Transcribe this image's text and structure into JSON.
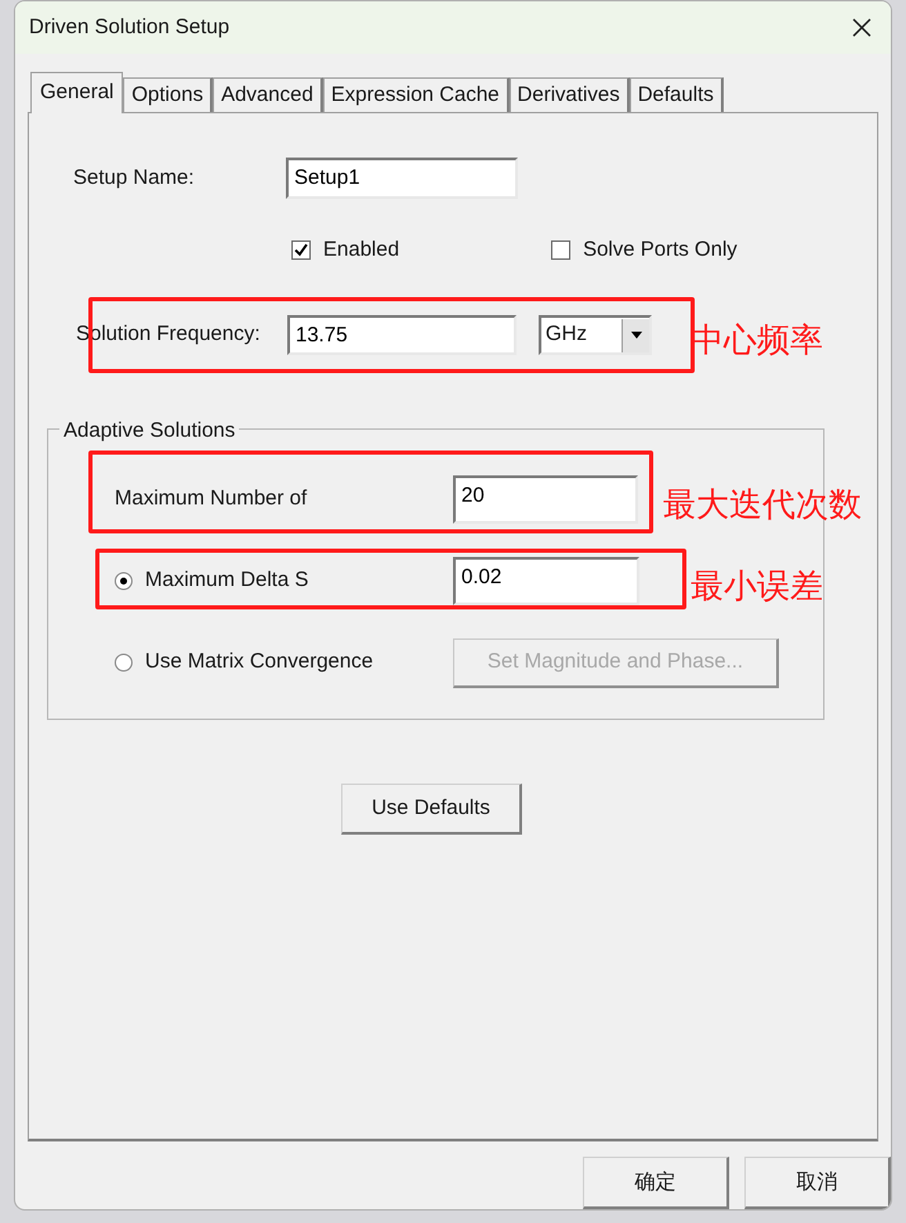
{
  "window": {
    "title": "Driven Solution Setup"
  },
  "tabs": [
    {
      "label": "General",
      "selected": true
    },
    {
      "label": "Options",
      "selected": false
    },
    {
      "label": "Advanced",
      "selected": false
    },
    {
      "label": "Expression Cache",
      "selected": false
    },
    {
      "label": "Derivatives",
      "selected": false
    },
    {
      "label": "Defaults",
      "selected": false
    }
  ],
  "setup_name": {
    "label": "Setup Name:",
    "value": "Setup1"
  },
  "checkboxes": [
    {
      "label": "Enabled",
      "checked": true
    },
    {
      "label": "Solve Ports Only",
      "checked": false
    }
  ],
  "solution_frequency": {
    "label": "Solution Frequency:",
    "value": "13.75",
    "unit": "GHz"
  },
  "adaptive_solutions": {
    "title": "Adaptive Solutions",
    "max_passes": {
      "label": "Maximum Number of",
      "value": "20"
    },
    "options": [
      {
        "label": "Maximum Delta S",
        "selected": true,
        "value": "0.02"
      },
      {
        "label": "Use Matrix Convergence",
        "selected": false,
        "button": "Set Magnitude and Phase...",
        "disabled": true
      }
    ]
  },
  "use_defaults_button": "Use Defaults",
  "buttons": [
    "确定",
    "取消"
  ],
  "annotations": [
    "中心频率",
    "最大迭代次数",
    "最小误差"
  ]
}
